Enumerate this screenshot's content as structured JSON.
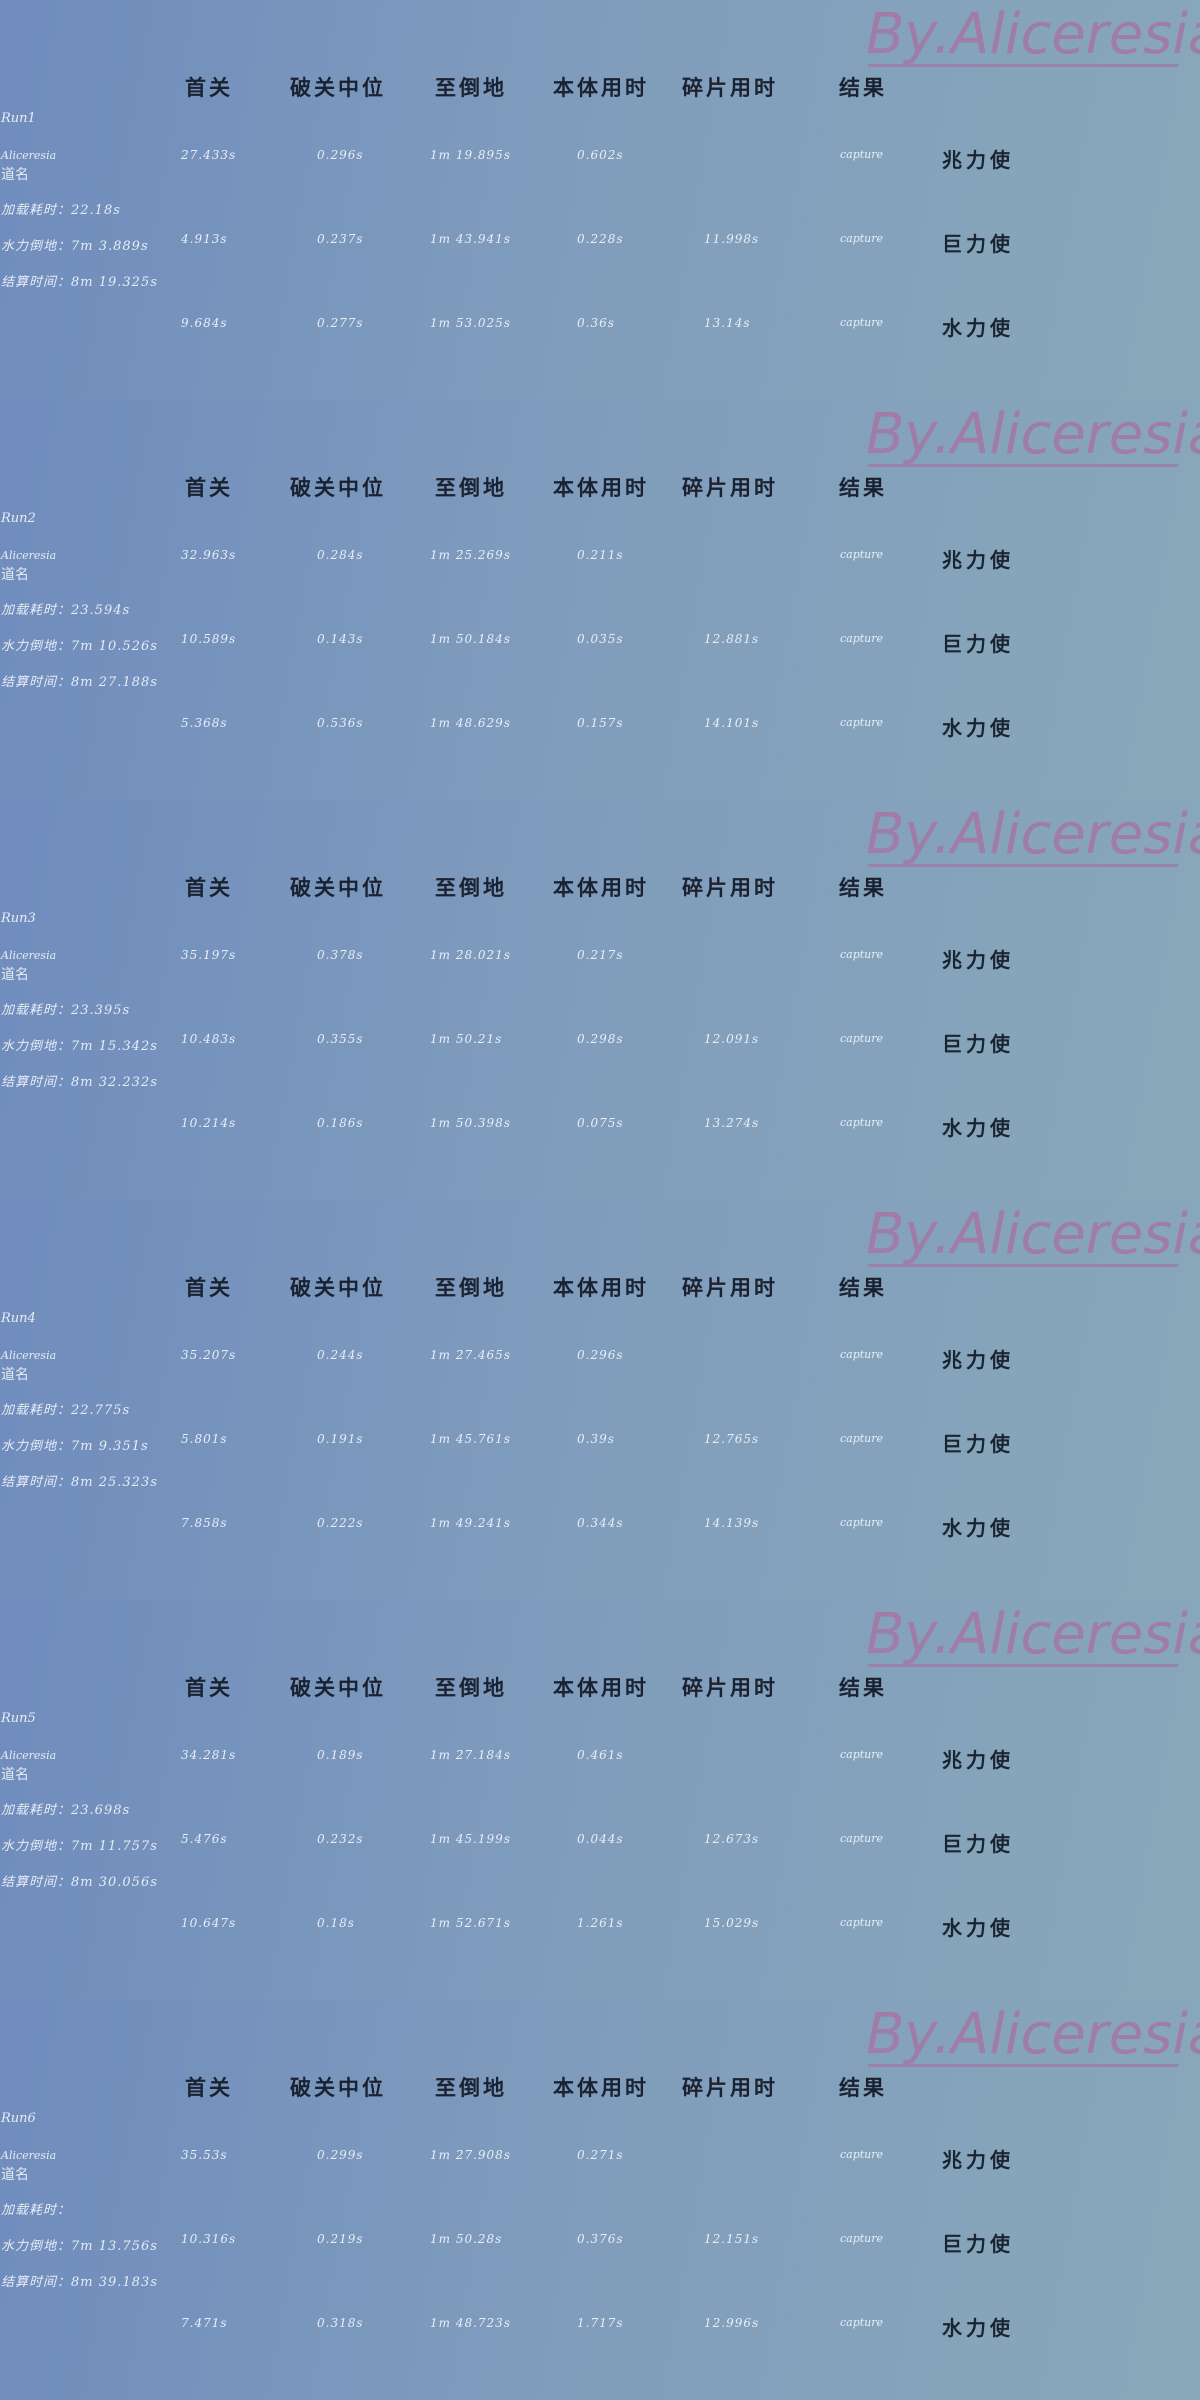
{
  "watermark": "By.Aliceresia",
  "headers": {
    "first": "首关",
    "median": "破关中位",
    "fall": "至倒地",
    "body": "本体用时",
    "frag": "碎片用时",
    "result": "结果"
  },
  "runs": [
    {
      "run_id": "Run1",
      "runner": "Aliceresia",
      "stage": "道名",
      "load": "加载耗时：22.18s",
      "water": "水力倒地：7m 3.889s",
      "total": "结算时间：8m 19.325s",
      "rows": [
        {
          "first": "27.433s",
          "median": "0.296s",
          "fall": "1m 19.895s",
          "body": "0.602s",
          "frag": "",
          "result": "capture",
          "label": "兆力使"
        },
        {
          "first": "4.913s",
          "median": "0.237s",
          "fall": "1m 43.941s",
          "body": "0.228s",
          "frag": "11.998s",
          "result": "capture",
          "label": "巨力使"
        },
        {
          "first": "9.684s",
          "median": "0.277s",
          "fall": "1m 53.025s",
          "body": "0.36s",
          "frag": "13.14s",
          "result": "capture",
          "label": "水力使"
        }
      ]
    },
    {
      "run_id": "Run2",
      "runner": "Aliceresia",
      "stage": "道名",
      "load": "加载耗时：23.594s",
      "water": "水力倒地：7m 10.526s",
      "total": "结算时间：8m 27.188s",
      "rows": [
        {
          "first": "32.963s",
          "median": "0.284s",
          "fall": "1m 25.269s",
          "body": "0.211s",
          "frag": "",
          "result": "capture",
          "label": "兆力使"
        },
        {
          "first": "10.589s",
          "median": "0.143s",
          "fall": "1m 50.184s",
          "body": "0.035s",
          "frag": "12.881s",
          "result": "capture",
          "label": "巨力使"
        },
        {
          "first": "5.368s",
          "median": "0.536s",
          "fall": "1m 48.629s",
          "body": "0.157s",
          "frag": "14.101s",
          "result": "capture",
          "label": "水力使"
        }
      ]
    },
    {
      "run_id": "Run3",
      "runner": "Aliceresia",
      "stage": "道名",
      "load": "加载耗时：23.395s",
      "water": "水力倒地：7m 15.342s",
      "total": "结算时间：8m 32.232s",
      "rows": [
        {
          "first": "35.197s",
          "median": "0.378s",
          "fall": "1m 28.021s",
          "body": "0.217s",
          "frag": "",
          "result": "capture",
          "label": "兆力使"
        },
        {
          "first": "10.483s",
          "median": "0.355s",
          "fall": "1m 50.21s",
          "body": "0.298s",
          "frag": "12.091s",
          "result": "capture",
          "label": "巨力使"
        },
        {
          "first": "10.214s",
          "median": "0.186s",
          "fall": "1m 50.398s",
          "body": "0.075s",
          "frag": "13.274s",
          "result": "capture",
          "label": "水力使"
        }
      ]
    },
    {
      "run_id": "Run4",
      "runner": "Aliceresia",
      "stage": "道名",
      "load": "加载耗时：22.775s",
      "water": "水力倒地：7m 9.351s",
      "total": "结算时间：8m 25.323s",
      "rows": [
        {
          "first": "35.207s",
          "median": "0.244s",
          "fall": "1m 27.465s",
          "body": "0.296s",
          "frag": "",
          "result": "capture",
          "label": "兆力使"
        },
        {
          "first": "5.801s",
          "median": "0.191s",
          "fall": "1m 45.761s",
          "body": "0.39s",
          "frag": "12.765s",
          "result": "capture",
          "label": "巨力使"
        },
        {
          "first": "7.858s",
          "median": "0.222s",
          "fall": "1m 49.241s",
          "body": "0.344s",
          "frag": "14.139s",
          "result": "capture",
          "label": "水力使"
        }
      ]
    },
    {
      "run_id": "Run5",
      "runner": "Aliceresia",
      "stage": "道名",
      "load": "加载耗时：23.698s",
      "water": "水力倒地：7m 11.757s",
      "total": "结算时间：8m 30.056s",
      "rows": [
        {
          "first": "34.281s",
          "median": "0.189s",
          "fall": "1m 27.184s",
          "body": "0.461s",
          "frag": "",
          "result": "capture",
          "label": "兆力使"
        },
        {
          "first": "5.476s",
          "median": "0.232s",
          "fall": "1m 45.199s",
          "body": "0.044s",
          "frag": "12.673s",
          "result": "capture",
          "label": "巨力使"
        },
        {
          "first": "10.647s",
          "median": "0.18s",
          "fall": "1m 52.671s",
          "body": "1.261s",
          "frag": "15.029s",
          "result": "capture",
          "label": "水力使"
        }
      ]
    },
    {
      "run_id": "Run6",
      "runner": "Aliceresia",
      "stage": "道名",
      "load": "加载耗时：",
      "water": "水力倒地：7m 13.756s",
      "total": "结算时间：8m 39.183s",
      "rows": [
        {
          "first": "35.53s",
          "median": "0.299s",
          "fall": "1m 27.908s",
          "body": "0.271s",
          "frag": "",
          "result": "capture",
          "label": "兆力使"
        },
        {
          "first": "10.316s",
          "median": "0.219s",
          "fall": "1m 50.28s",
          "body": "0.376s",
          "frag": "12.151s",
          "result": "capture",
          "label": "巨力使"
        },
        {
          "first": "7.471s",
          "median": "0.318s",
          "fall": "1m 48.723s",
          "body": "1.717s",
          "frag": "12.996s",
          "result": "capture",
          "label": "水力使"
        }
      ]
    }
  ]
}
